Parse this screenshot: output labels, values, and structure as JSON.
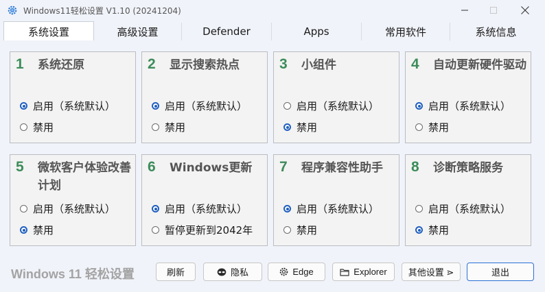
{
  "window": {
    "title": "Windows11轻松设置 V1.10 (20241204)",
    "accent_color": "#1f5fbf",
    "number_color": "#3c8c5a"
  },
  "tabs": [
    {
      "label": "系统设置",
      "active": true
    },
    {
      "label": "高级设置",
      "active": false
    },
    {
      "label": "Defender",
      "active": false
    },
    {
      "label": "Apps",
      "active": false
    },
    {
      "label": "常用软件",
      "active": false
    },
    {
      "label": "系统信息",
      "active": false
    }
  ],
  "cards": [
    {
      "num": "1",
      "title": "系统还原",
      "options": [
        "启用（系统默认）",
        "禁用"
      ],
      "selected": 0
    },
    {
      "num": "2",
      "title": "显示搜索热点",
      "options": [
        "启用（系统默认）",
        "禁用"
      ],
      "selected": 0
    },
    {
      "num": "3",
      "title": "小组件",
      "options": [
        "启用（系统默认）",
        "禁用"
      ],
      "selected": 1
    },
    {
      "num": "4",
      "title": "自动更新硬件驱动",
      "options": [
        "启用（系统默认）",
        "禁用"
      ],
      "selected": 0
    },
    {
      "num": "5",
      "title": "微软客户体验改善计划",
      "options": [
        "启用（系统默认）",
        "禁用"
      ],
      "selected": 1
    },
    {
      "num": "6",
      "title": "Windows更新",
      "options": [
        "启用（系统默认）",
        "暂停更新到2042年"
      ],
      "selected": 0
    },
    {
      "num": "7",
      "title": "程序兼容性助手",
      "options": [
        "启用（系统默认）",
        "禁用"
      ],
      "selected": 0
    },
    {
      "num": "8",
      "title": "诊断策略服务",
      "options": [
        "启用（系统默认）",
        "禁用"
      ],
      "selected": 1
    }
  ],
  "footer": {
    "brand": "Windows 11 轻松设置",
    "buttons": {
      "refresh": "刷新",
      "privacy": "隐私",
      "edge": "Edge",
      "explorer": "Explorer",
      "more": "其他设置 ⋗",
      "exit": "退出"
    },
    "icons": {
      "privacy": "alien-icon",
      "edge": "gear-icon",
      "explorer": "folder-icon"
    }
  }
}
